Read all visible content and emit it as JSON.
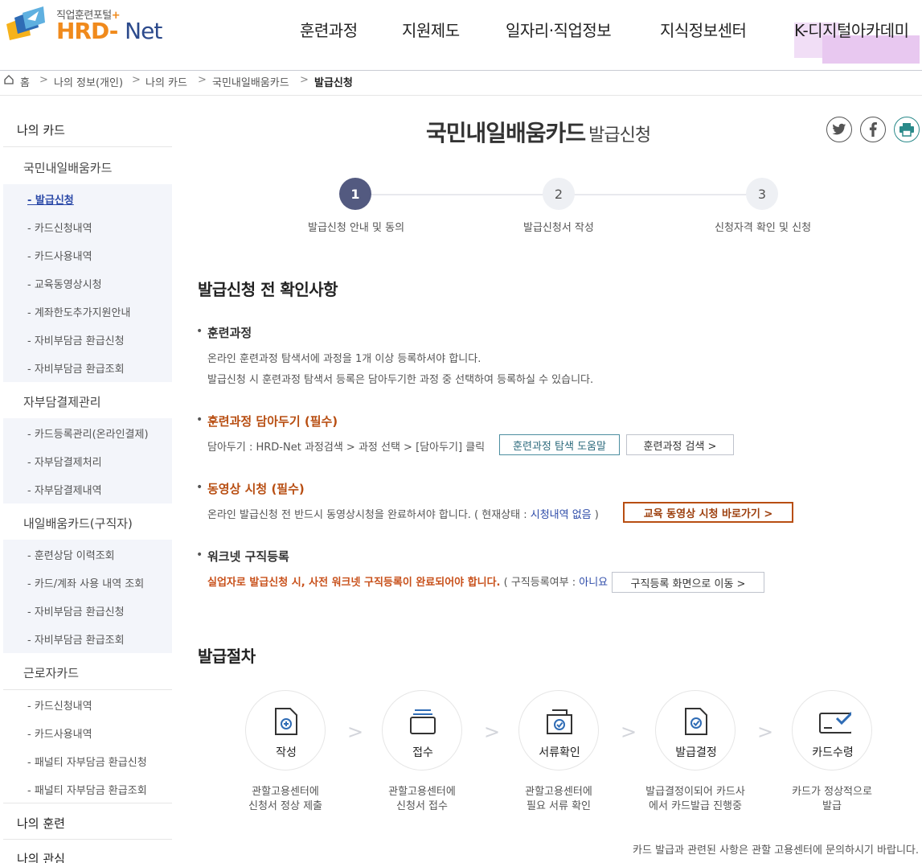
{
  "logo": {
    "sub": "직업훈련포털",
    "sub_plus": "+",
    "hrd": "HRD",
    "dash": "-",
    "net": "Net"
  },
  "gnb": [
    "훈련과정",
    "지원제도",
    "일자리·직업정보",
    "지식정보센터",
    "K-디지털아카데미"
  ],
  "breadcrumb": [
    "홈",
    "나의 정보(개인)",
    "나의 카드",
    "국민내일배움카드",
    "발급신청"
  ],
  "sidebar": {
    "title": "나의 카드",
    "group1": {
      "title": "국민내일배움카드",
      "items": [
        "- 발급신청",
        "- 카드신청내역",
        "- 카드사용내역",
        "- 교육동영상시청",
        "- 계좌한도추가지원안내",
        "- 자비부담금 환급신청",
        "- 자비부담금 환급조회"
      ]
    },
    "group2": {
      "title": "자부담결제관리",
      "items": [
        "- 카드등록관리(온라인결제)",
        "- 자부담결제처리",
        "- 자부담결제내역"
      ]
    },
    "group3": {
      "title": "내일배움카드(구직자)",
      "items": [
        "- 훈련상담 이력조회",
        "- 카드/계좌 사용 내역 조회",
        "- 자비부담금 환급신청",
        "- 자비부담금 환급조회"
      ]
    },
    "group4": {
      "title": "근로자카드",
      "items": [
        "- 카드신청내역",
        "- 카드사용내역",
        "- 패널티 자부담금 환급신청",
        "- 패널티 자부담금 환급조회"
      ]
    },
    "training": "나의 훈련",
    "interest": "나의 관심"
  },
  "page": {
    "title": "국민내일배움카드",
    "subtitle": "발급신청"
  },
  "steps": [
    {
      "num": "1",
      "label": "발급신청 안내 및 동의"
    },
    {
      "num": "2",
      "label": "발급신청서 작성"
    },
    {
      "num": "3",
      "label": "신청자격 확인 및 신청"
    }
  ],
  "checklist": {
    "title": "발급신청 전 확인사항",
    "course": {
      "title": "훈련과정",
      "line1": "온라인 훈련과정 탐색서에 과정을 1개 이상 등록하셔야 합니다.",
      "line2": "발급신청 시 훈련과정 탐색서 등록은 담아두기한 과정 중 선택하여 등록하실 수 있습니다."
    },
    "save": {
      "title": "훈련과정 담아두기 (필수)",
      "desc": "담아두기 : HRD-Net 과정검색 > 과정 선택 > [담아두기] 클릭",
      "btn_help": "훈련과정 탐색 도움말",
      "btn_search": "훈련과정 검색 >"
    },
    "video": {
      "title": "동영상 시청 (필수)",
      "desc": "온라인 발급신청 전 반드시 동영상시청을 완료하셔야 합니다. ( 현재상태 : ",
      "status": "시청내역 없음",
      "desc_end": " )",
      "btn": "교육 동영상 시청 바로가기 >"
    },
    "worknet": {
      "title": "워크넷 구직등록",
      "warn": "실업자로 발급신청 시, 사전 워크넷 구직등록이 완료되어야 합니다.",
      "desc": " ( 구직등록여부 : ",
      "status": "아니요",
      "desc_end": " )",
      "btn": "구직등록 화면으로 이동 >"
    }
  },
  "process": {
    "title": "발급절차",
    "steps": [
      {
        "label": "작성",
        "desc": "관할고용센터에\n신청서 정상 제출"
      },
      {
        "label": "접수",
        "desc": "관할고용센터에\n신청서 접수"
      },
      {
        "label": "서류확인",
        "desc": "관할고용센터에\n필요 서류 확인"
      },
      {
        "label": "발급결정",
        "desc": "발급결정이되어 카드사\n에서 카드발급 진행중"
      },
      {
        "label": "카드수령",
        "desc": "카드가 정상적으로\n발급"
      }
    ]
  },
  "footer_note": "카드 발급과 관련된 사항은 관할 고용센터에 문의하시기 바랍니다.",
  "colors": {
    "accent": "#535a80",
    "orange": "#b84e12",
    "brand_orange": "#f08a1c",
    "brand_blue": "#2c4a8c",
    "link_blue": "#2c4aa8"
  }
}
